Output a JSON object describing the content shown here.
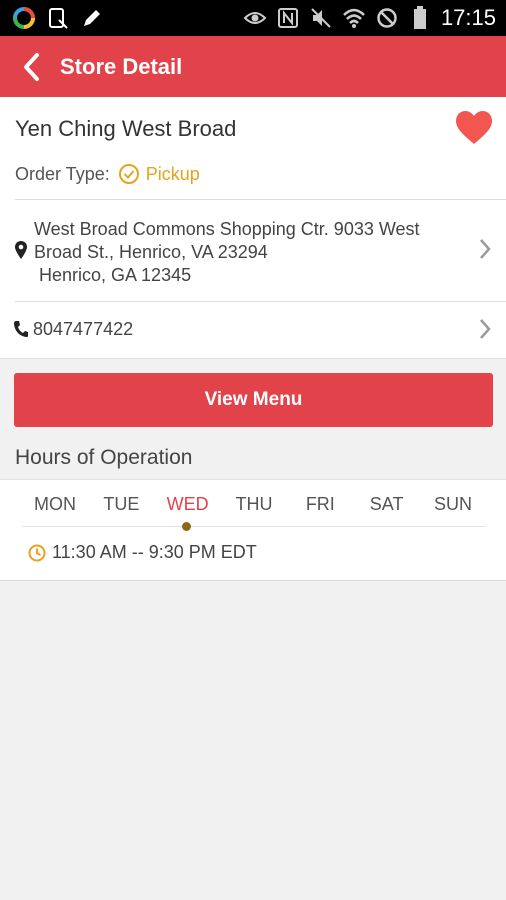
{
  "status_bar": {
    "time": "17:15",
    "left_icons": [
      "app-icon",
      "tablet-icon",
      "pencil-icon"
    ],
    "right_icons": [
      "eye-icon",
      "nfc-icon",
      "mute-icon",
      "wifi-icon",
      "no-disturb-icon",
      "battery-icon"
    ]
  },
  "app_bar": {
    "title": "Store Detail"
  },
  "store": {
    "name": "Yen Ching West Broad",
    "order_type_label": "Order Type:",
    "order_type_value": "Pickup",
    "address_line1": "West Broad Commons Shopping Ctr. 9033 West",
    "address_line2": "Broad St., Henrico, VA 23294",
    "address_line3": "Henrico, GA 12345",
    "phone": "8047477422"
  },
  "view_menu_label": "View Menu",
  "hours": {
    "title": "Hours of Operation",
    "days": [
      "MON",
      "TUE",
      "WED",
      "THU",
      "FRI",
      "SAT",
      "SUN"
    ],
    "selected_day": "WED",
    "time_range": "11:30 AM -- 9:30 PM EDT"
  },
  "colors": {
    "brand_red": "#e2434a",
    "pickup_orange": "#e8a21d",
    "heart_red": "#f2574f"
  }
}
